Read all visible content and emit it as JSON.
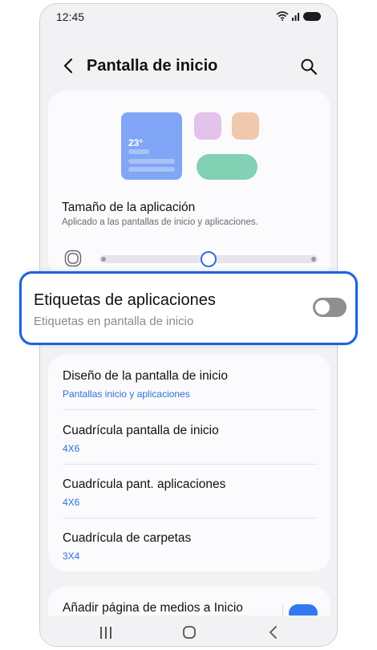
{
  "status_bar": {
    "time": "12:45"
  },
  "header": {
    "title": "Pantalla de inicio"
  },
  "preview": {
    "temperature": "23°"
  },
  "app_size": {
    "title": "Tamaño de la aplicación",
    "subtitle": "Aplicado a las pantallas de inicio y aplicaciones.",
    "slider_level_fraction": 0.5
  },
  "app_labels": {
    "title": "Etiquetas de aplicaciones",
    "subtitle": "Etiquetas en pantalla de inicio",
    "enabled": false
  },
  "settings_list": [
    {
      "title": "Diseño de la pantalla de inicio",
      "value": "Pantallas inicio y aplicaciones"
    },
    {
      "title": "Cuadrícula pantalla de inicio",
      "value": "4X6"
    },
    {
      "title": "Cuadrícula pant. aplicaciones",
      "value": "4X6"
    },
    {
      "title": "Cuadrícula de carpetas",
      "value": "3X4"
    }
  ],
  "media_page": {
    "title": "Añadir página de medios a Inicio",
    "enabled": true
  },
  "colors": {
    "accent": "#1d63d8",
    "toggle_off": "#8e8e93",
    "link_text": "#2f6fd4"
  },
  "icons": {
    "back": "chevron-left-icon",
    "search": "search-icon",
    "wifi": "wifi-icon",
    "signal": "signal-icon",
    "battery": "battery-icon",
    "app_size": "app-size-icon",
    "nav_recents": "recents-icon",
    "nav_home": "home-icon",
    "nav_back": "nav-back-icon"
  }
}
